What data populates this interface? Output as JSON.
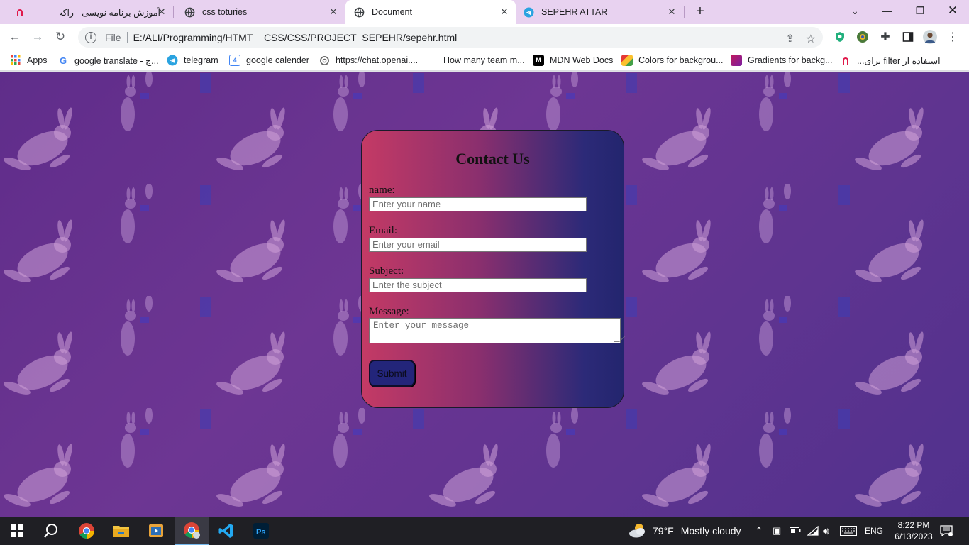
{
  "browser": {
    "tabs": [
      {
        "title": "آموزش برنامه نویسی - راکت",
        "icon": "rocket-favicon-icon",
        "active": false
      },
      {
        "title": "css toturies",
        "icon": "globe-icon",
        "active": false
      },
      {
        "title": "Document",
        "icon": "globe-icon",
        "active": true
      },
      {
        "title": "SEPEHR ATTAR",
        "icon": "telegram-icon",
        "active": false
      }
    ],
    "new_tab": "+",
    "url_scheme": "File",
    "url": "E:/ALI/Programming/HTMT__CSS/CSS/PROJECT_SEPEHR/sepehr.html",
    "bookmarks": [
      {
        "label": "Apps",
        "icon": "apps-grid-icon"
      },
      {
        "label": "google translate - ج...",
        "icon": "google-icon"
      },
      {
        "label": "telegram",
        "icon": "telegram-icon"
      },
      {
        "label": "google calender",
        "icon": "calendar-icon"
      },
      {
        "label": "https://chat.openai....",
        "icon": "openai-icon"
      },
      {
        "label": "How many team m...",
        "icon": "blank-page-icon"
      },
      {
        "label": "MDN Web Docs",
        "icon": "mdn-icon"
      },
      {
        "label": "Colors for backgrou...",
        "icon": "colors-icon"
      },
      {
        "label": "Gradients for backg...",
        "icon": "gradient-icon"
      },
      {
        "label": "استفاده از filter برای...",
        "icon": "rocket-favicon-icon"
      }
    ]
  },
  "form": {
    "title": "Contact Us",
    "name_label": "name:",
    "name_placeholder": "Enter your name",
    "email_label": "Email:",
    "email_placeholder": "Enter your email",
    "subject_label": "Subject:",
    "subject_placeholder": "Enter the subject",
    "message_label": "Message:",
    "message_placeholder": "Enter your message",
    "submit_label": "Submit"
  },
  "taskbar": {
    "weather_temp": "79°F",
    "weather_text": "Mostly cloudy",
    "language": "ENG",
    "time": "8:22 PM",
    "date": "6/13/2023"
  },
  "colors": {
    "tab_strip": "#e8d2f0",
    "card_left": "#c43a65",
    "card_right": "#23256e",
    "submit_bg": "#23257a",
    "taskbar": "#1f1f24"
  }
}
